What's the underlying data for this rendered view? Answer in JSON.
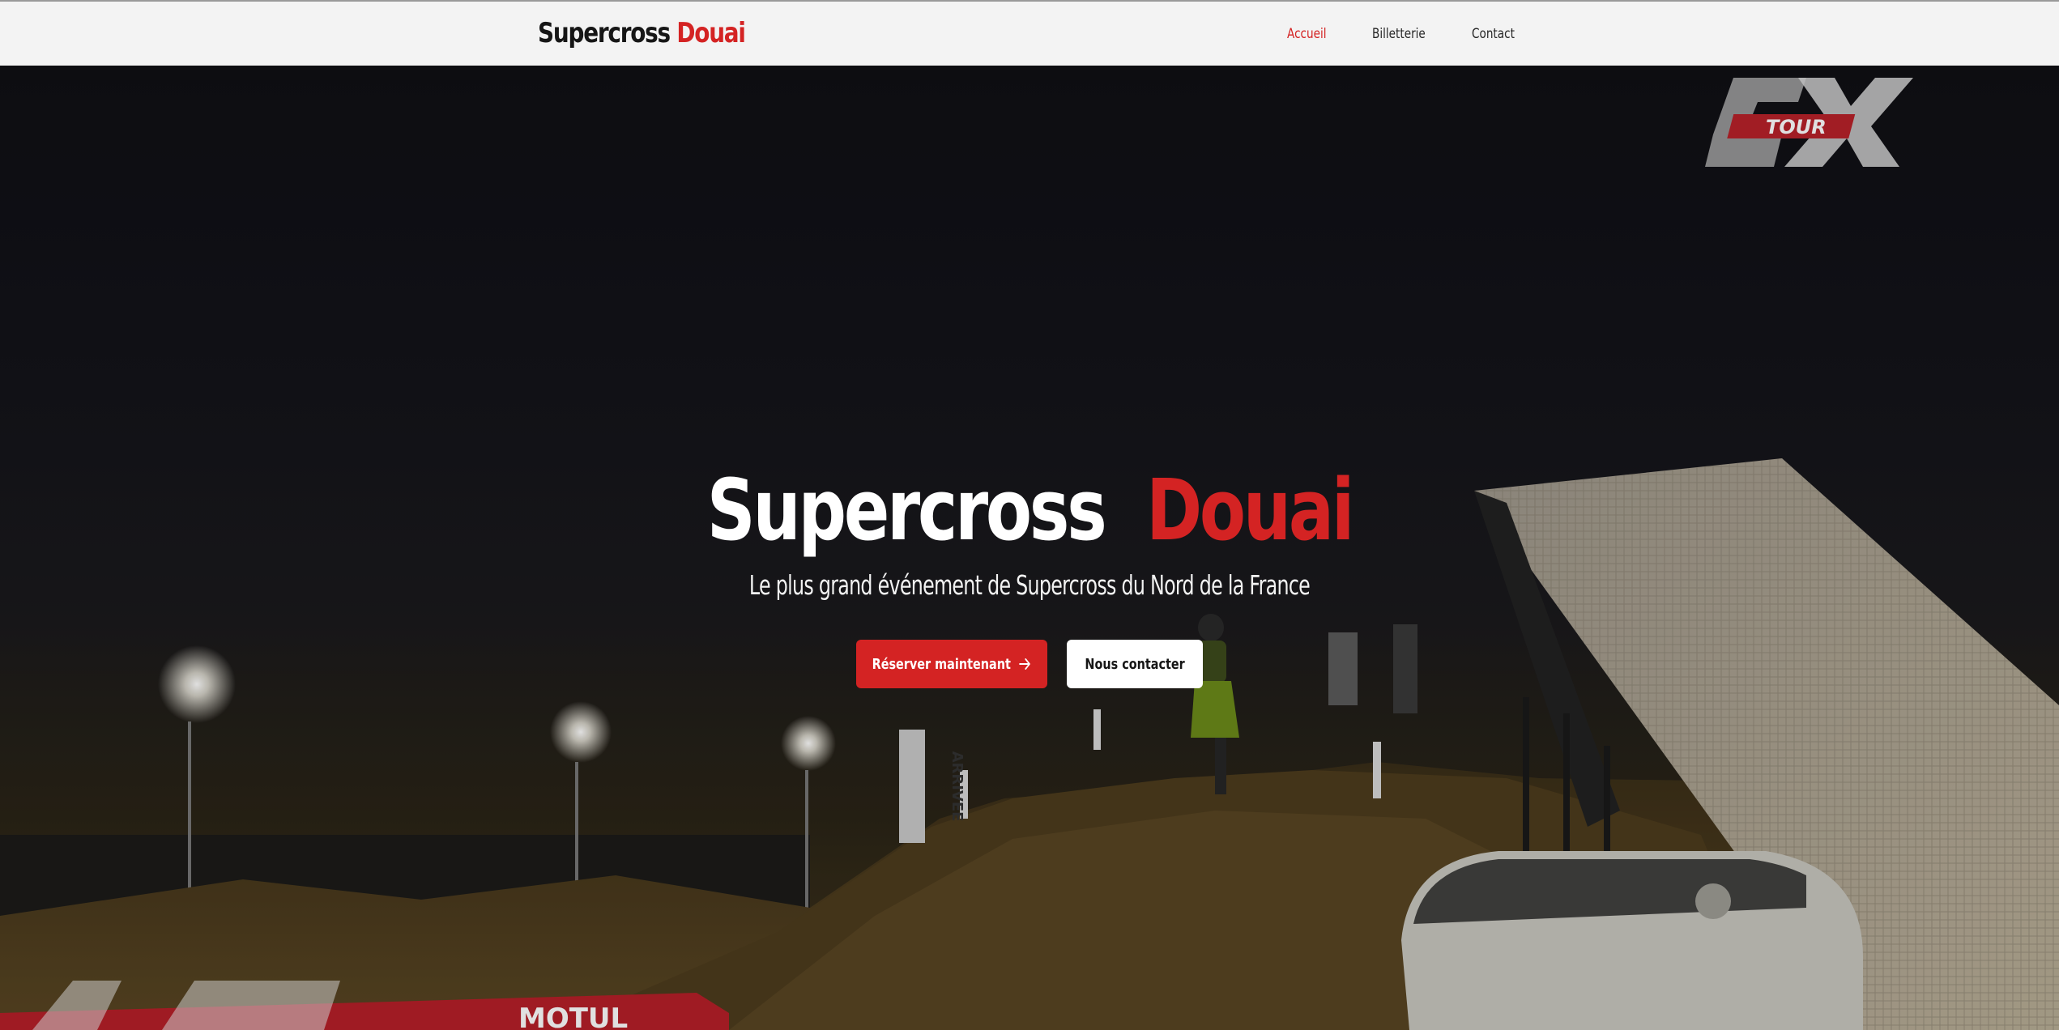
{
  "navbar": {
    "brand": {
      "main": "Supercross",
      "accent": "Douai"
    },
    "links": [
      {
        "label": "Accueil",
        "active": true
      },
      {
        "label": "Billetterie",
        "active": false
      },
      {
        "label": "Contact",
        "active": false
      }
    ]
  },
  "hero": {
    "title": {
      "main": "Supercross",
      "accent": "Douai"
    },
    "subtitle": "Le plus grand événement de Supercross du Nord de la France",
    "buttons": {
      "primary": {
        "label": "Réserver maintenant",
        "icon": "arrow-right-icon"
      },
      "secondary": {
        "label": "Nous contacter"
      }
    },
    "background_texts": {
      "logo_tag": "TOUR",
      "banner_text": "MOTUL",
      "ramp_sign": "ARRIVEE"
    }
  },
  "colors": {
    "accent": "#d42323",
    "navbar_bg": "#f3f3f3",
    "text_dark": "#161616",
    "white": "#ffffff"
  }
}
